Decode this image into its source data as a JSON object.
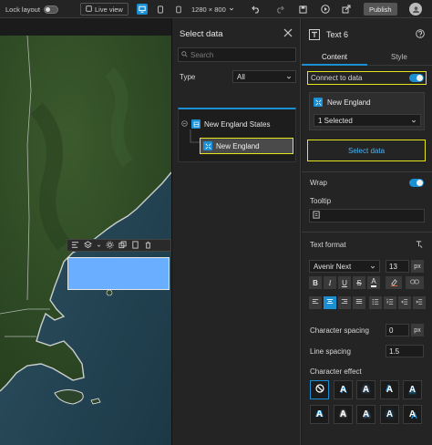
{
  "topbar": {
    "lock_layout_label": "Lock layout",
    "live_view_label": "Live view",
    "resolution_label": "1280 × 800",
    "publish_label": "Publish",
    "accent": "#1a8fd4"
  },
  "select_data_panel": {
    "title": "Select data",
    "search_placeholder": "Search",
    "type_label": "Type",
    "type_value": "All",
    "tree": {
      "parent_label": "New England States",
      "child_label": "New England"
    }
  },
  "settings_panel": {
    "widget_title": "Text 6",
    "tabs": [
      "Content",
      "Style"
    ],
    "connect_to_data_label": "Connect to data",
    "data_source_name": "New England",
    "selection_value": "1 Selected",
    "select_data_button": "Select data",
    "wrap_label": "Wrap",
    "tooltip_label": "Tooltip",
    "text_format_label": "Text format",
    "font_family_value": "Avenir Next",
    "font_size_value": "13",
    "font_size_unit": "px",
    "char_spacing_label": "Character spacing",
    "char_spacing_value": "0",
    "char_spacing_unit": "px",
    "line_spacing_label": "Line spacing",
    "line_spacing_value": "1.5",
    "char_effect_label": "Character effect",
    "highlight_color": "#e6e61a"
  }
}
